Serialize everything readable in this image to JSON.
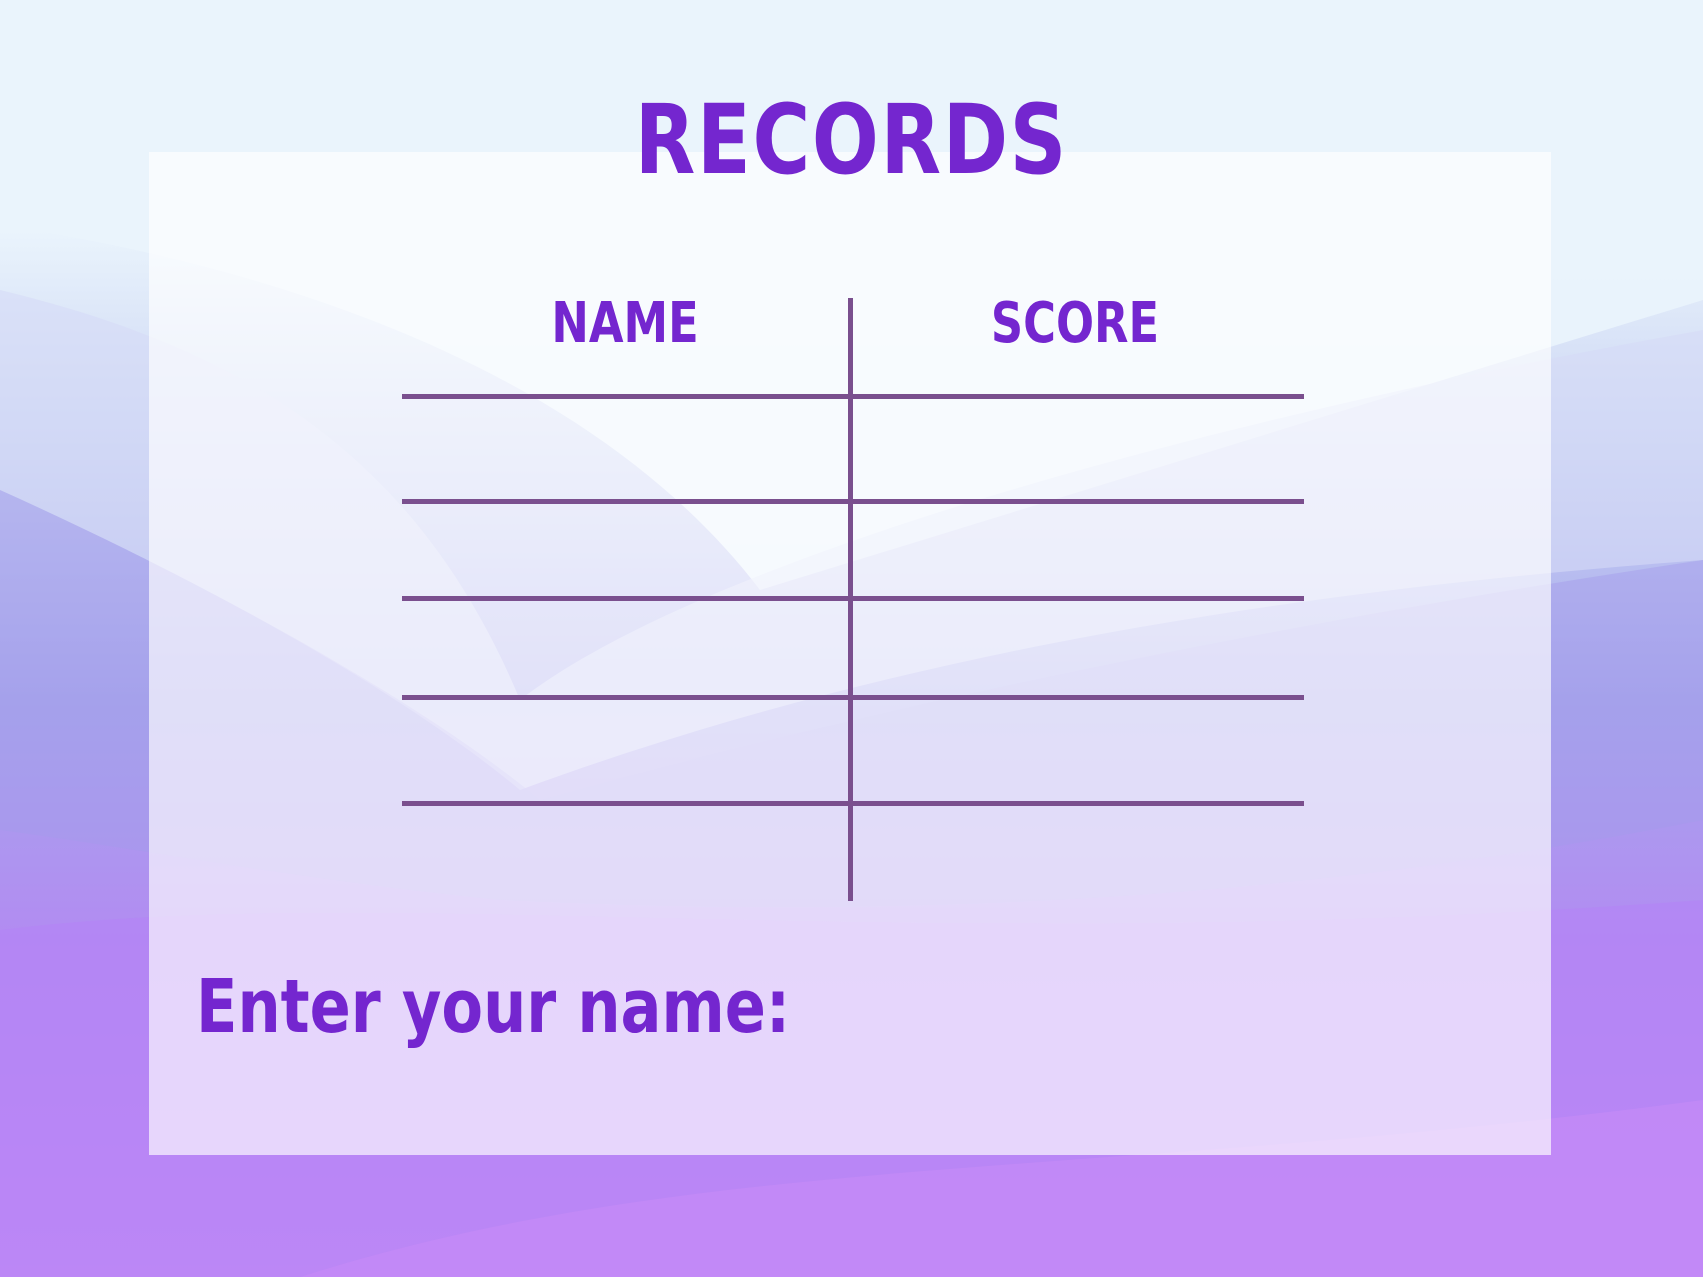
{
  "colors": {
    "text": "#7426cf",
    "lines": "#7a4f8e"
  },
  "title": "RECORDS",
  "table": {
    "columns": [
      "NAME",
      "SCORE"
    ],
    "rows": [
      {
        "name": "",
        "score": ""
      },
      {
        "name": "",
        "score": ""
      },
      {
        "name": "",
        "score": ""
      },
      {
        "name": "",
        "score": ""
      }
    ]
  },
  "prompt": {
    "label": "Enter your name:",
    "value": ""
  }
}
